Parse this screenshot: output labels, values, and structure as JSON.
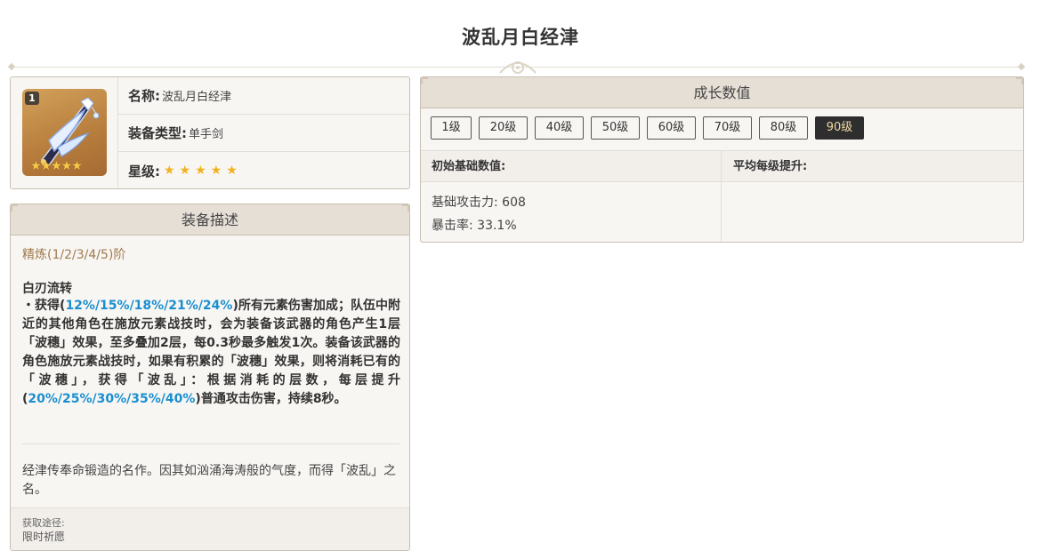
{
  "page_title": "波乱月白经津",
  "info": {
    "rarity_badge": "1",
    "image_stars": "★★★★★",
    "name_label": "名称:",
    "name_value": "波乱月白经津",
    "type_label": "装备类型:",
    "type_value": "单手剑",
    "star_label": "星级:",
    "stars": "★★★★★"
  },
  "description": {
    "header": "装备描述",
    "refine": "精炼(1/2/3/4/5)阶",
    "skill_name": "白刃流转",
    "skill_p1": "・获得(",
    "skill_v1": "12%/15%/18%/21%/24%",
    "skill_p2": ")所有元素伤害加成；队伍中附近的其他角色在施放元素战技时，会为装备该武器的角色产生1层「波穗」效果，至多叠加2层，每0.3秒最多触发1次。装备该武器的角色施放元素战技时，如果有积累的「波穗」效果，则将消耗已有的「波穗」，获得「波乱」：根据消耗的层数，每层提升(",
    "skill_v2": "20%/25%/30%/35%/40%",
    "skill_p3": ")普通攻击伤害，持续8秒。",
    "lore": "经津传奉命锻造的名作。因其如汹涌海涛般的气度，而得「波乱」之名。",
    "source_label": "获取途径:",
    "source_value": "限时祈愿"
  },
  "growth": {
    "header": "成长数值",
    "levels": [
      "1级",
      "20级",
      "40级",
      "50级",
      "60级",
      "70级",
      "80级",
      "90级"
    ],
    "active_level": "90级",
    "col_base": "初始基础数值:",
    "col_avg": "平均每级提升:",
    "stat_atk": "基础攻击力: 608",
    "stat_crit": "暴击率: 33.1%"
  }
}
